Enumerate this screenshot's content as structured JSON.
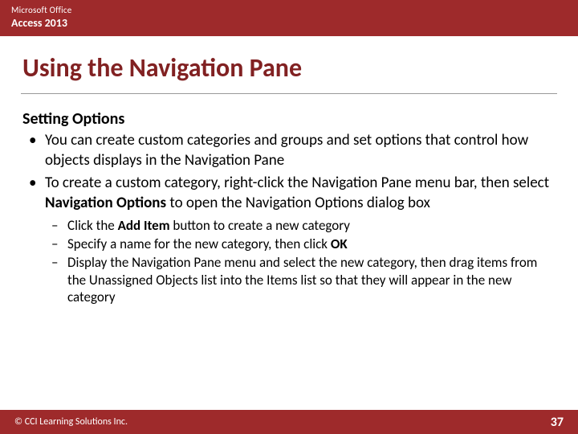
{
  "header": {
    "brand": "Microsoft Office",
    "product": "Access 2013"
  },
  "title": "Using the Navigation Pane",
  "subhead": "Setting Options",
  "bullets": [
    {
      "parts": [
        {
          "text": "You can create custom categories and groups and set options that control how objects displays in the Navigation Pane",
          "bold": false
        }
      ]
    },
    {
      "parts": [
        {
          "text": "To create a custom category, right-click the Navigation Pane menu bar, then select ",
          "bold": false
        },
        {
          "text": "Navigation Options",
          "bold": true
        },
        {
          "text": " to open the Navigation Options dialog box",
          "bold": false
        }
      ]
    }
  ],
  "sub_bullets": [
    {
      "parts": [
        {
          "text": "Click the ",
          "bold": false
        },
        {
          "text": "Add Item",
          "bold": true
        },
        {
          "text": " button to create a new category",
          "bold": false
        }
      ]
    },
    {
      "parts": [
        {
          "text": "Specify a name for the new category, then click ",
          "bold": false
        },
        {
          "text": "OK",
          "bold": true
        }
      ]
    },
    {
      "parts": [
        {
          "text": "Display the Navigation Pane menu and select the new category, then drag items from the Unassigned Objects list into the Items list so that they will appear in the new category",
          "bold": false
        }
      ]
    }
  ],
  "footer": {
    "copyright": "© CCI Learning Solutions Inc.",
    "page": "37"
  }
}
